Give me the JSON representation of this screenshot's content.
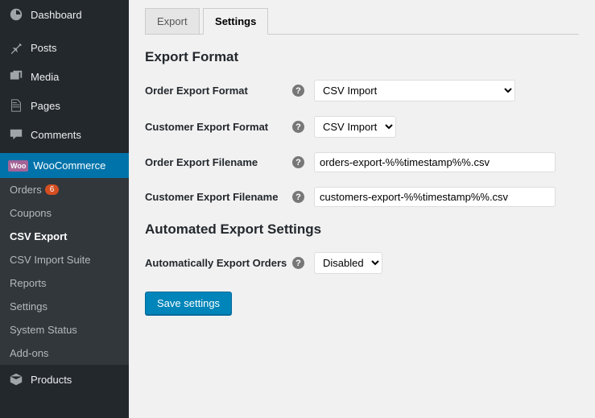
{
  "sidebar": {
    "dashboard": "Dashboard",
    "posts": "Posts",
    "media": "Media",
    "pages": "Pages",
    "comments": "Comments",
    "products": "Products",
    "woocommerce": {
      "label": "WooCommerce",
      "badge": "Woo"
    },
    "sub": {
      "orders": "Orders",
      "orders_count": "6",
      "coupons": "Coupons",
      "csv_export": "CSV Export",
      "csv_import": "CSV Import Suite",
      "reports": "Reports",
      "settings": "Settings",
      "system_status": "System Status",
      "addons": "Add-ons"
    }
  },
  "tabs": {
    "export": "Export",
    "settings": "Settings"
  },
  "sections": {
    "format": "Export Format",
    "auto": "Automated Export Settings"
  },
  "fields": {
    "order_format_label": "Order Export Format",
    "customer_format_label": "Customer Export Format",
    "order_filename_label": "Order Export Filename",
    "customer_filename_label": "Customer Export Filename",
    "auto_export_label": "Automatically Export Orders"
  },
  "values": {
    "order_format": "CSV Import",
    "customer_format": "CSV Import",
    "order_filename": "orders-export-%%timestamp%%.csv",
    "customer_filename": "customers-export-%%timestamp%%.csv",
    "auto_export": "Disabled"
  },
  "buttons": {
    "save": "Save settings"
  }
}
